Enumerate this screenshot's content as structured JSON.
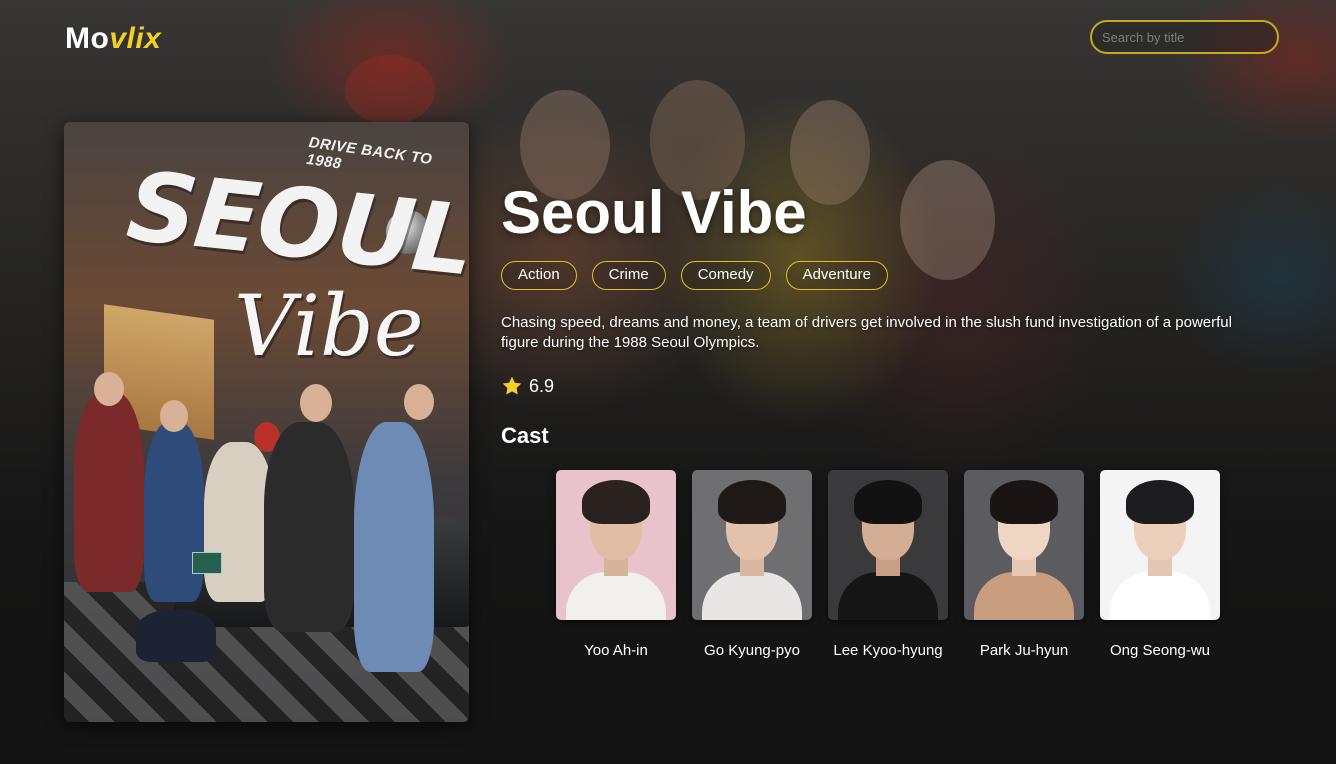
{
  "header": {
    "logo_part1": "Mo",
    "logo_part2": "vlix",
    "search_placeholder": "Search by title"
  },
  "movie": {
    "title": "Seoul Vibe",
    "genres": [
      "Action",
      "Crime",
      "Comedy",
      "Adventure"
    ],
    "overview": "Chasing speed, dreams and money, a team of drivers get involved in the slush fund investigation of a powerful figure during the 1988 Seoul Olympics.",
    "rating": "6.9",
    "rating_icon": "star-icon",
    "poster": {
      "tagline": "DRIVE BACK TO 1988",
      "title_word1": "SEOUL",
      "title_word2": "Vibe",
      "plate": "1988"
    }
  },
  "cast": {
    "heading": "Cast",
    "members": [
      {
        "name": "Yoo Ah-in"
      },
      {
        "name": "Go Kyung-pyo"
      },
      {
        "name": "Lee Kyoo-hyung"
      },
      {
        "name": "Park Ju-hyun"
      },
      {
        "name": "Ong Seong-wu"
      }
    ]
  },
  "colors": {
    "accent": "#f3cf2c",
    "background": "#141414",
    "text": "#ffffff"
  }
}
